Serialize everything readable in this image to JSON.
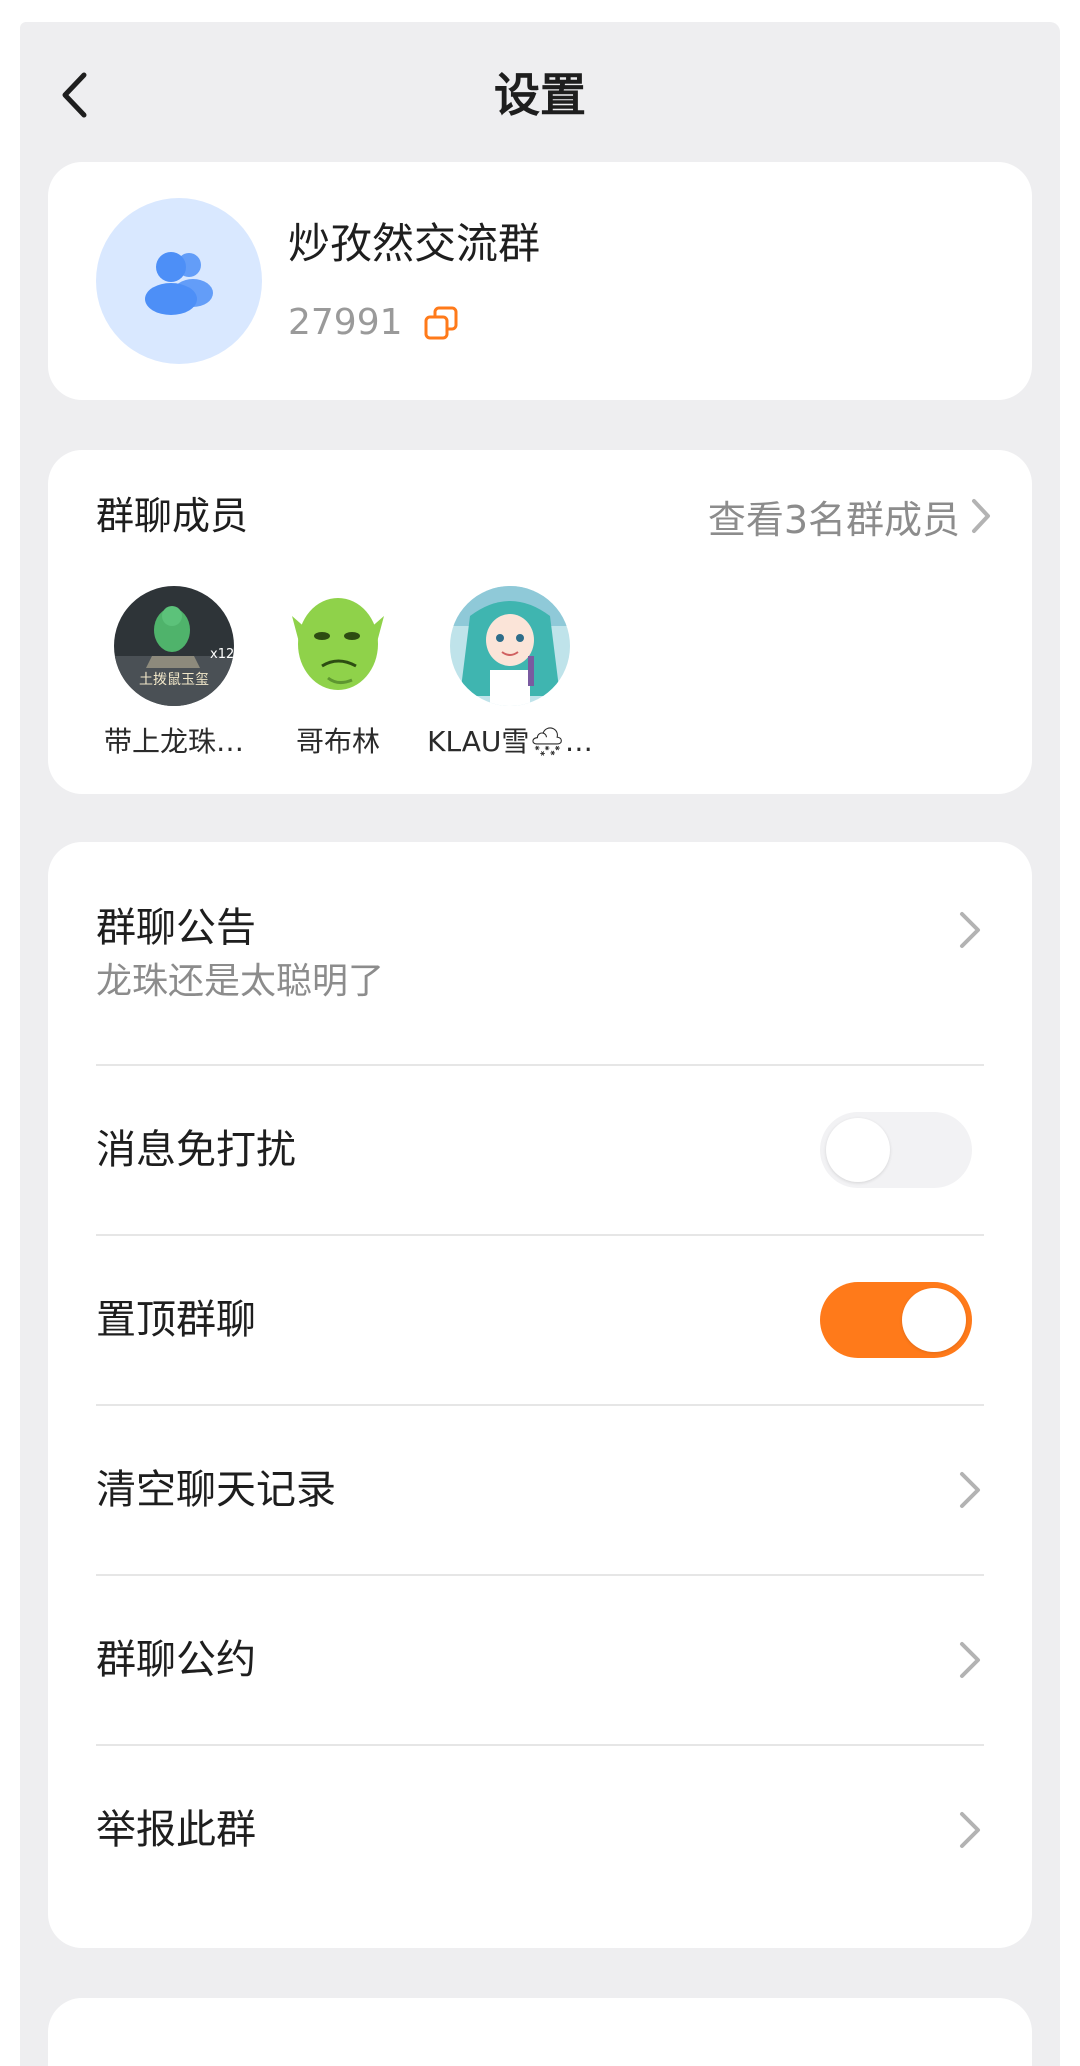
{
  "header": {
    "title": "设置"
  },
  "group": {
    "name": "炒孜然交流群",
    "id": "27991",
    "avatar_icon": "group-users-icon",
    "avatar_bg": "#d9e8ff",
    "avatar_fg": "#4d8ff7"
  },
  "members": {
    "title": "群聊成员",
    "link_label": "查看3名群成员",
    "list": [
      {
        "name": "带上龙珠…",
        "avatar_text": "土拨鼠玉玺",
        "avatar_badge": "x12"
      },
      {
        "name": "哥布林"
      },
      {
        "name": "KLAU雪🌨…"
      }
    ]
  },
  "settings": {
    "announcement": {
      "label": "群聊公告",
      "content": "龙珠还是太聪明了"
    },
    "mute": {
      "label": "消息免打扰",
      "enabled": false
    },
    "pin": {
      "label": "置顶群聊",
      "enabled": true
    },
    "clear_history": {
      "label": "清空聊天记录"
    },
    "rules": {
      "label": "群聊公约"
    },
    "report": {
      "label": "举报此群"
    }
  },
  "colors": {
    "accent": "#ff7a1a",
    "background": "#eeeef0",
    "card": "#ffffff"
  }
}
